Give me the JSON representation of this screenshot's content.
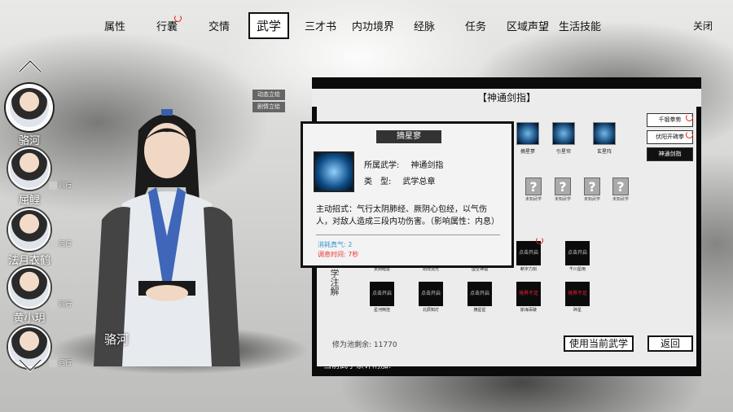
{
  "nav": {
    "items": [
      "属性",
      "行囊",
      "交情",
      "武学",
      "三才书",
      "内功境界",
      "经脉",
      "任务",
      "区域声望",
      "生活技能"
    ],
    "active": "武学",
    "close_label": "关闭"
  },
  "party": {
    "members": [
      {
        "name": "骆河",
        "selected": true,
        "companion_label": ""
      },
      {
        "name": "屈鲤",
        "selected": false,
        "companion_label": "同行"
      },
      {
        "name": "法月衣鹤",
        "selected": false,
        "companion_label": "同行"
      },
      {
        "name": "黄小玥",
        "selected": false,
        "companion_label": "同行"
      },
      {
        "name": "",
        "selected": false,
        "companion_label": "同行"
      }
    ]
  },
  "hero": {
    "name": "骆河",
    "buttons": [
      "动态立绘",
      "剧情立绘"
    ]
  },
  "panel": {
    "title": "【神通剑指】",
    "section_label": "学注解",
    "skill_row": [
      {
        "caption": "摘星寥"
      },
      {
        "caption": "引星帘"
      },
      {
        "caption": "玄星阵"
      }
    ],
    "locked_unknown": [
      "未知武学",
      "未知武学",
      "未知武学",
      "未知武学"
    ],
    "slots_row1": [
      {
        "state": "",
        "caption": "太阴暗雷"
      },
      {
        "state": "",
        "caption": "阳烁流光"
      },
      {
        "state": "",
        "caption": "虚空神指"
      },
      {
        "state": "点击开启",
        "caption": "断字力剑"
      },
      {
        "state": "点击开启",
        "caption": "千川星雨"
      }
    ],
    "slots_row2": [
      {
        "state": "点击开启",
        "caption": "星河倒挂",
        "red": false
      },
      {
        "state": "点击开启",
        "caption": "北辰知灯",
        "red": false
      },
      {
        "state": "点击开启",
        "caption": "摘星星",
        "red": false
      },
      {
        "state": "境界不足",
        "caption": "斯海百破",
        "red": true
      },
      {
        "state": "境界不足",
        "caption": "碎星",
        "red": true
      }
    ],
    "right_tabs": [
      "千锻拳势",
      "伏阳开碑拳",
      "神通剑指"
    ],
    "pool_label": "修为池剩余:",
    "pool_value": "11770",
    "use_button": "使用当前武学",
    "back_button": "返回",
    "bottom_label": "当前武学累计附加:"
  },
  "tooltip": {
    "name": "摘星寥",
    "school_key": "所属武学:",
    "school_value": "神通剑指",
    "type_key": "类　型:",
    "type_value": "武学总章",
    "description": "主动招式：气行太阴肺经、厥阴心包经，以气伤人，对敌人造成三段内功伤害。（影响属性：内息）",
    "cost_label": "消耗真气: 2",
    "cooldown_label": "调息时间: 7秒"
  },
  "colors": {
    "ink": "#111111",
    "cost_blue": "#3399cc",
    "cooldown_red": "#ee3333",
    "accent_red": "#dd2222"
  }
}
